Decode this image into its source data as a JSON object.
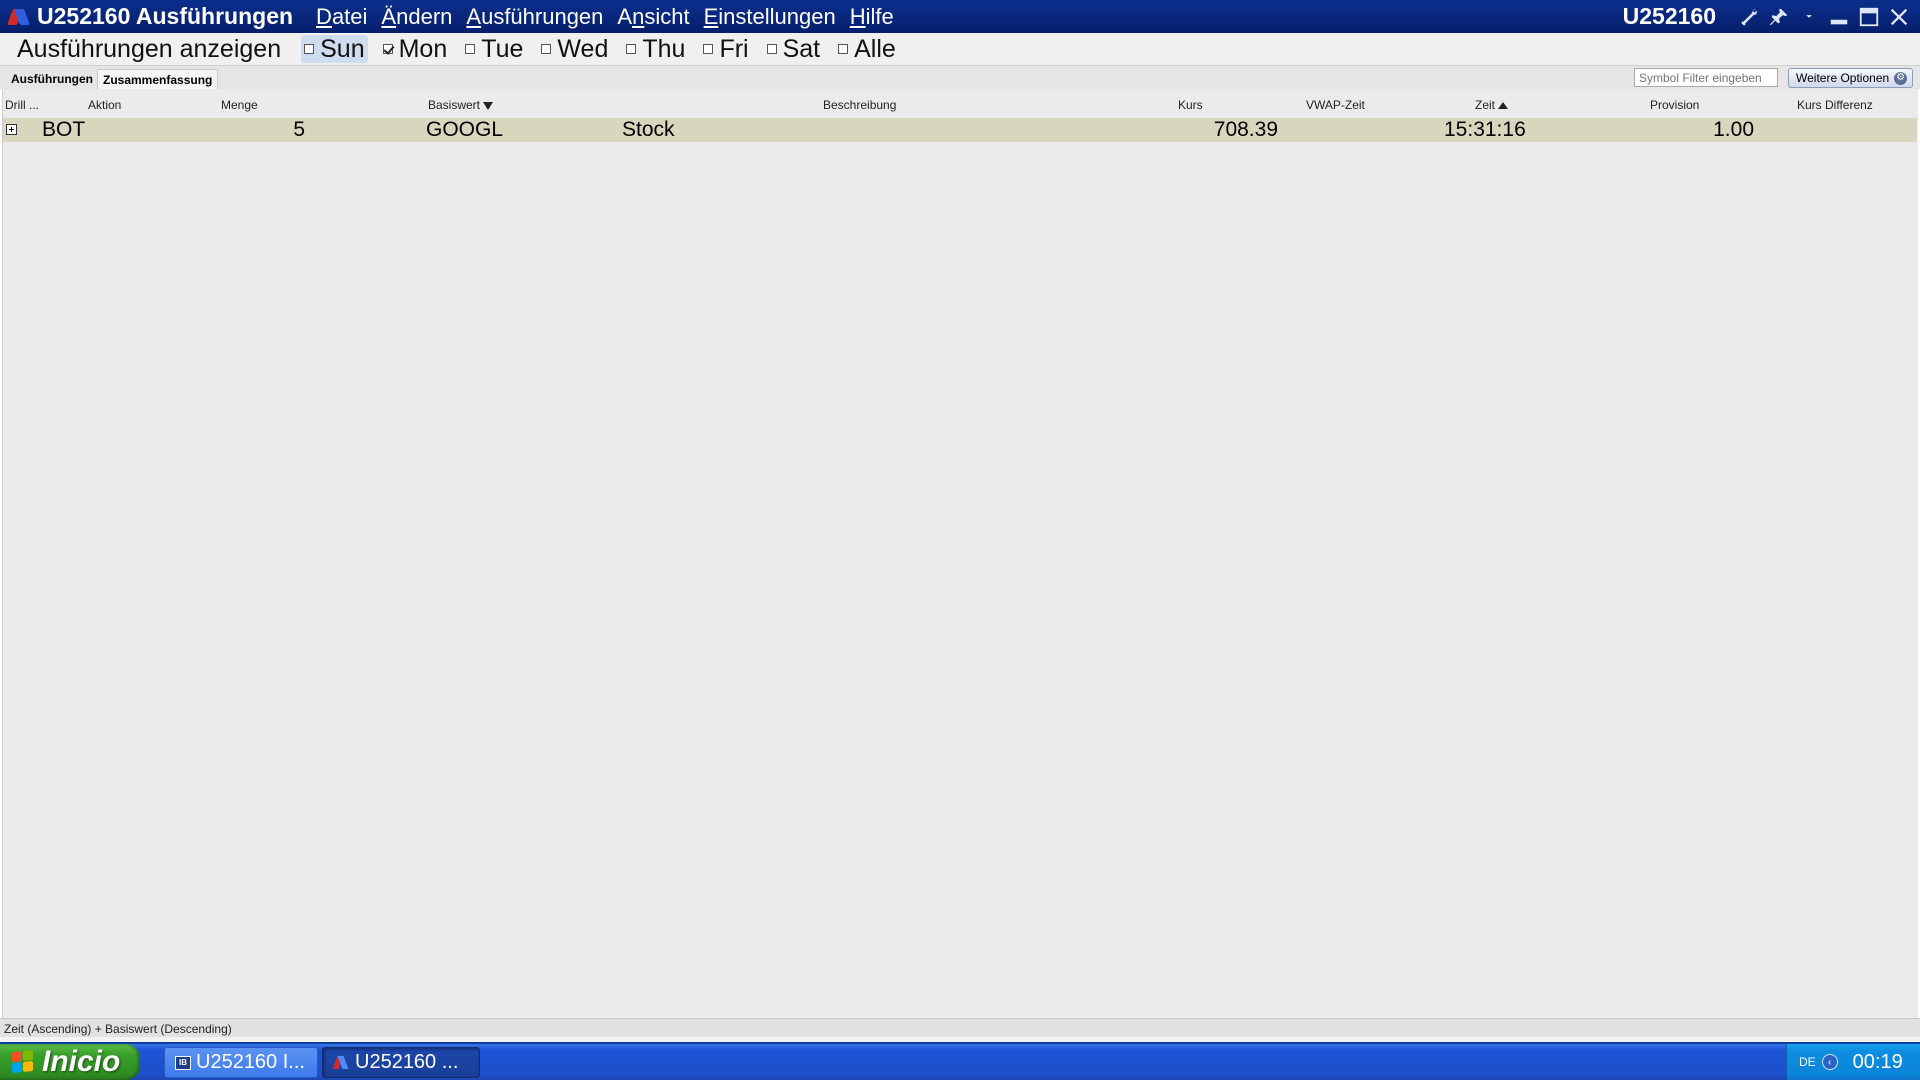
{
  "window": {
    "title": "U252160 Ausführungen",
    "account": "U252160"
  },
  "menu": [
    {
      "pre": "",
      "acc": "D",
      "post": "atei"
    },
    {
      "pre": "",
      "acc": "Ä",
      "post": "ndern"
    },
    {
      "pre": "",
      "acc": "A",
      "post": "usführungen"
    },
    {
      "pre": "A",
      "acc": "n",
      "post": "sicht"
    },
    {
      "pre": "",
      "acc": "E",
      "post": "instellungen"
    },
    {
      "pre": "",
      "acc": "H",
      "post": "ilfe"
    }
  ],
  "filter": {
    "label": "Ausführungen anzeigen",
    "days": [
      {
        "label": "Sun",
        "checked": false,
        "active": true
      },
      {
        "label": "Mon",
        "checked": true,
        "active": false
      },
      {
        "label": "Tue",
        "checked": false,
        "active": false
      },
      {
        "label": "Wed",
        "checked": false,
        "active": false
      },
      {
        "label": "Thu",
        "checked": false,
        "active": false
      },
      {
        "label": "Fri",
        "checked": false,
        "active": false
      },
      {
        "label": "Sat",
        "checked": false,
        "active": false
      },
      {
        "label": "Alle",
        "checked": false,
        "active": false
      }
    ]
  },
  "tabs": {
    "executions": "Ausführungen",
    "summary": "Zusammenfassung",
    "selected": "summary"
  },
  "symbol_filter": {
    "placeholder": "Symbol Filter eingeben"
  },
  "more_options": "Weitere Optionen",
  "columns": {
    "drill": "Drill ...",
    "action": "Aktion",
    "quantity": "Menge",
    "underlying": "Basiswert",
    "description": "Beschreibung",
    "price": "Kurs",
    "vwap_time": "VWAP-Zeit",
    "time": "Zeit",
    "commission": "Provision",
    "price_diff": "Kurs Differenz"
  },
  "rows": [
    {
      "action": "BOT",
      "quantity": "5",
      "underlying": "GOOGL",
      "type": "Stock",
      "price": "708.39",
      "time": "15:31:16",
      "commission": "1.00"
    }
  ],
  "status": "Zeit (Ascending)  +  Basiswert (Descending)",
  "taskbar": {
    "start": "Inicio",
    "task1": "U252160 I...",
    "task2": "U252160 ...",
    "lang": "DE",
    "clock": "00:19"
  },
  "colors": {
    "titlebar": "#0b2e8c",
    "row_highlight": "#d8d6bd",
    "taskbar": "#1e55d6",
    "start_green": "#38a02b"
  }
}
